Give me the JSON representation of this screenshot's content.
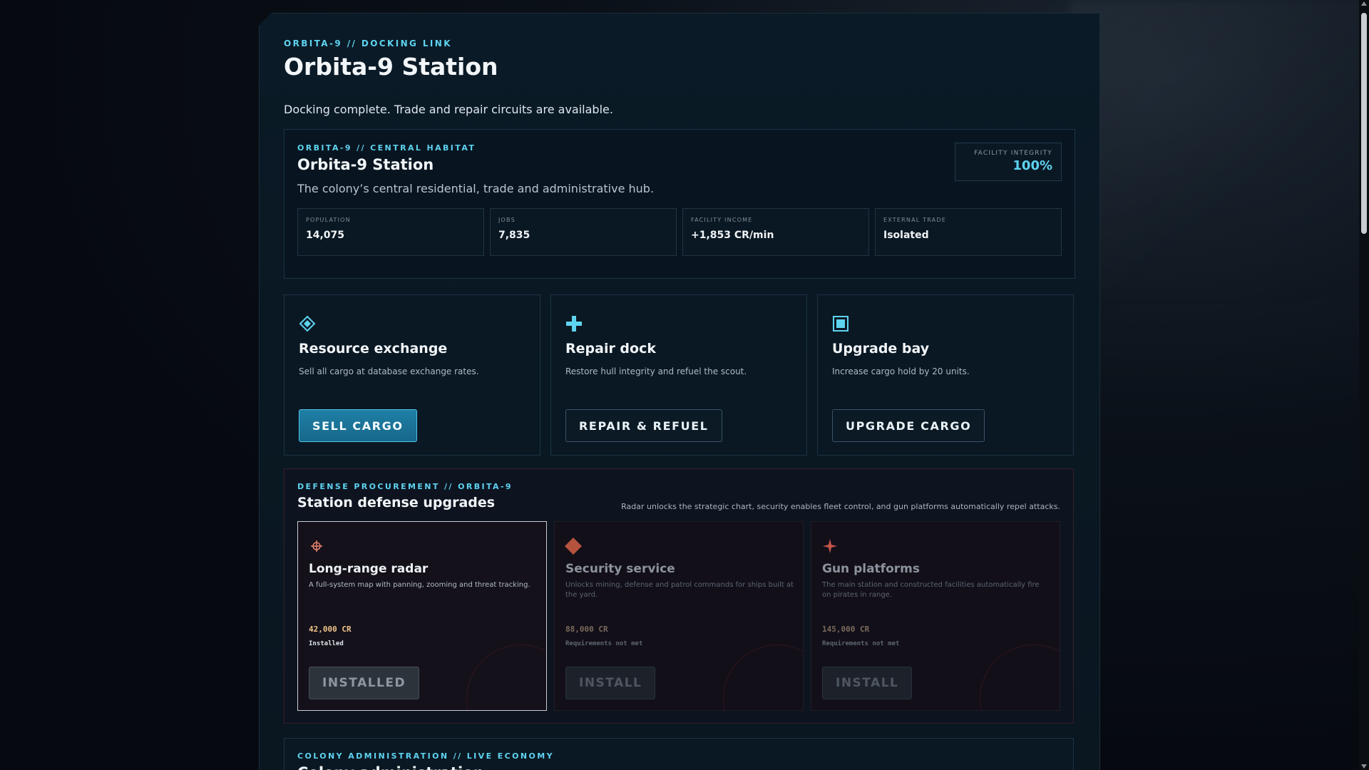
{
  "header": {
    "kicker": "ORBITA-9 // DOCKING LINK",
    "title": "Orbita-9 Station",
    "subtitle": "Docking complete. Trade and repair circuits are available."
  },
  "habitat": {
    "kicker": "ORBITA-9 // CENTRAL HABITAT",
    "title": "Orbita-9 Station",
    "description": "The colony’s central residential, trade and administrative hub.",
    "integrity_label": "FACILITY INTEGRITY",
    "integrity_value": "100%",
    "stats": [
      {
        "label": "POPULATION",
        "value": "14,075"
      },
      {
        "label": "JOBS",
        "value": "7,835"
      },
      {
        "label": "FACILITY INCOME",
        "value": "+1,853 CR/min"
      },
      {
        "label": "EXTERNAL TRADE",
        "value": "Isolated"
      }
    ]
  },
  "services": [
    {
      "icon": "diamond-icon",
      "title": "Resource exchange",
      "description": "Sell all cargo at database exchange rates.",
      "button": "SELL CARGO"
    },
    {
      "icon": "plus-icon",
      "title": "Repair dock",
      "description": "Restore hull integrity and refuel the scout.",
      "button": "REPAIR & REFUEL"
    },
    {
      "icon": "square-icon",
      "title": "Upgrade bay",
      "description": "Increase cargo hold by 20 units.",
      "button": "UPGRADE CARGO"
    }
  ],
  "defense": {
    "kicker": "DEFENSE PROCUREMENT // ORBITA-9",
    "title": "Station defense upgrades",
    "note": "Radar unlocks the strategic chart, security enables fleet control, and gun platforms automatically repel attacks.",
    "cards": [
      {
        "icon": "radar-icon",
        "title": "Long-range radar",
        "description": "A full-system map with panning, zooming and threat tracking.",
        "price": "42,000 CR",
        "state": "Installed",
        "button": "INSTALLED"
      },
      {
        "icon": "shield-diamond-icon",
        "title": "Security service",
        "description": "Unlocks mining, defense and patrol commands for ships built at the yard.",
        "price": "88,000 CR",
        "state": "Requirements not met",
        "button": "INSTALL"
      },
      {
        "icon": "star-icon",
        "title": "Gun platforms",
        "description": "The main station and constructed facilities automatically fire on pirates in range.",
        "price": "145,000 CR",
        "state": "Requirements not met",
        "button": "INSTALL"
      }
    ]
  },
  "colony": {
    "kicker": "COLONY ADMINISTRATION // LIVE ECONOMY",
    "title": "Colony administration"
  },
  "colors": {
    "accent": "#5ed3f0",
    "primary_button": "#1f7fa6",
    "price": "#f0c48c",
    "danger_border": "#3a1e25"
  }
}
